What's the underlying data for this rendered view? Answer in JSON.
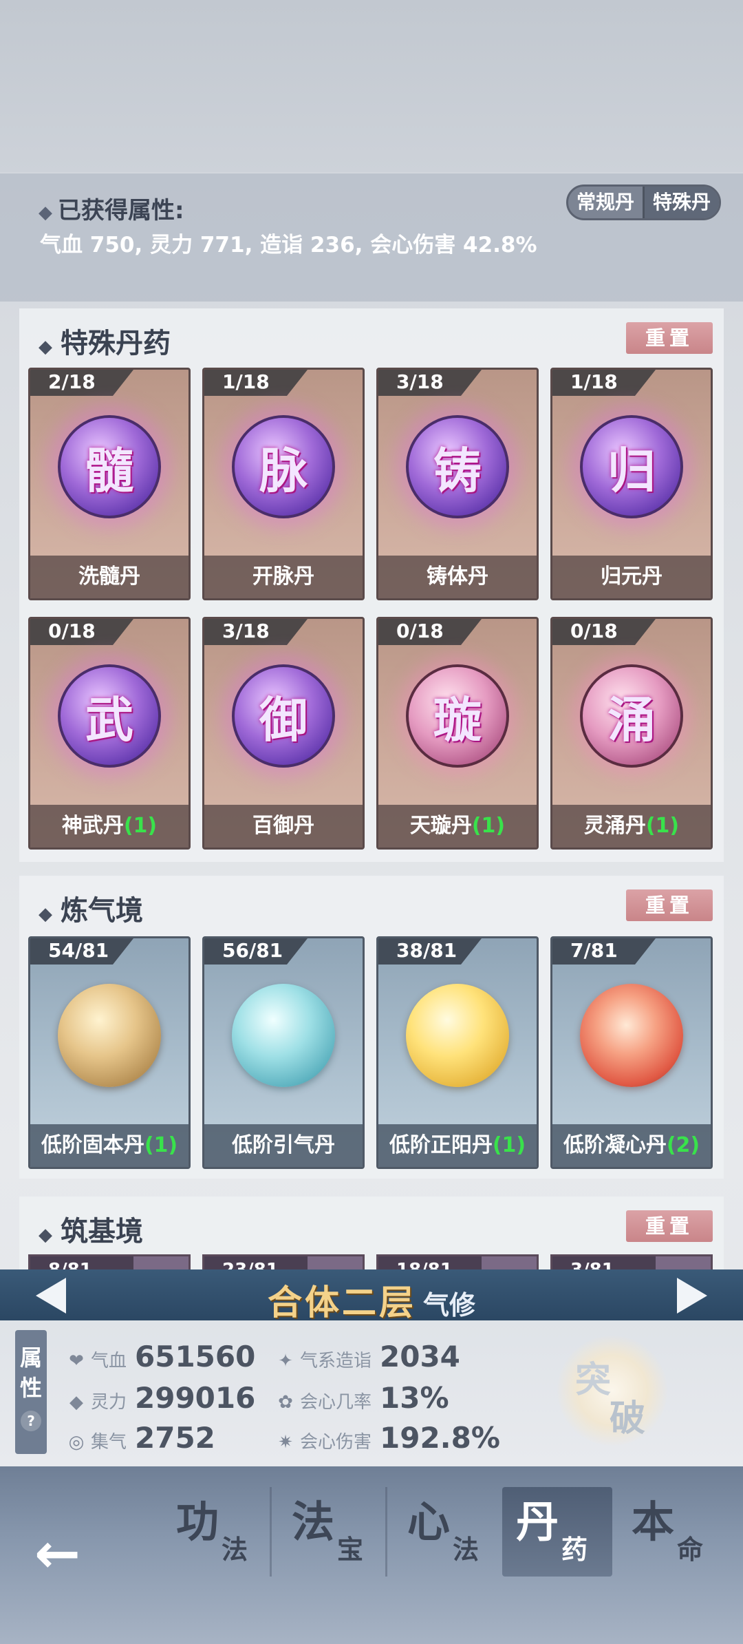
{
  "obtained": {
    "title": "已获得属性:",
    "values": "气血 750, 灵力 771, 造诣 236, 会心伤害 42.8%",
    "toggle": [
      "常规丹",
      "特殊丹"
    ]
  },
  "sections": [
    {
      "title": "特殊丹药",
      "reset_label": "重置",
      "cards": [
        {
          "count": "2/18",
          "glyph": "髓",
          "name": "洗髓丹",
          "bonus": ""
        },
        {
          "count": "1/18",
          "glyph": "脉",
          "name": "开脉丹",
          "bonus": ""
        },
        {
          "count": "3/18",
          "glyph": "铸",
          "name": "铸体丹",
          "bonus": ""
        },
        {
          "count": "1/18",
          "glyph": "归",
          "name": "归元丹",
          "bonus": ""
        },
        {
          "count": "0/18",
          "glyph": "武",
          "name": "神武丹",
          "bonus": "(1)"
        },
        {
          "count": "3/18",
          "glyph": "御",
          "name": "百御丹",
          "bonus": ""
        },
        {
          "count": "0/18",
          "glyph": "璇",
          "name": "天璇丹",
          "bonus": "(1)"
        },
        {
          "count": "0/18",
          "glyph": "涌",
          "name": "灵涌丹",
          "bonus": "(1)"
        }
      ]
    },
    {
      "title": "炼气境",
      "reset_label": "重置",
      "cards": [
        {
          "count": "54/81",
          "name": "低阶固本丹",
          "bonus": "(1)"
        },
        {
          "count": "56/81",
          "name": "低阶引气丹",
          "bonus": ""
        },
        {
          "count": "38/81",
          "name": "低阶正阳丹",
          "bonus": "(1)"
        },
        {
          "count": "7/81",
          "name": "低阶凝心丹",
          "bonus": "(2)"
        }
      ]
    },
    {
      "title": "筑基境",
      "reset_label": "重置",
      "peek_counts": [
        "8/81",
        "23/81",
        "18/81",
        "3/81"
      ]
    }
  ],
  "realm": {
    "main": "合体二层",
    "sub": "气修"
  },
  "stats": {
    "tab": [
      "属",
      "性"
    ],
    "help": "?",
    "items": [
      {
        "icon": "❤",
        "label": "气血",
        "value": "651560"
      },
      {
        "icon": "✦",
        "label": "气系造诣",
        "value": "2034"
      },
      {
        "icon": "◆",
        "label": "灵力",
        "value": "299016"
      },
      {
        "icon": "✿",
        "label": "会心几率",
        "value": "13%"
      },
      {
        "icon": "◎",
        "label": "集气",
        "value": "2752"
      },
      {
        "icon": "✷",
        "label": "会心伤害",
        "value": "192.8%"
      }
    ],
    "breakthrough": [
      "突",
      "破"
    ]
  },
  "nav": {
    "back": "←",
    "items": [
      {
        "big": "功",
        "small": "法"
      },
      {
        "big": "法",
        "small": "宝"
      },
      {
        "big": "心",
        "small": "法"
      },
      {
        "big": "丹",
        "small": "药"
      },
      {
        "big": "本",
        "small": "命"
      }
    ]
  }
}
